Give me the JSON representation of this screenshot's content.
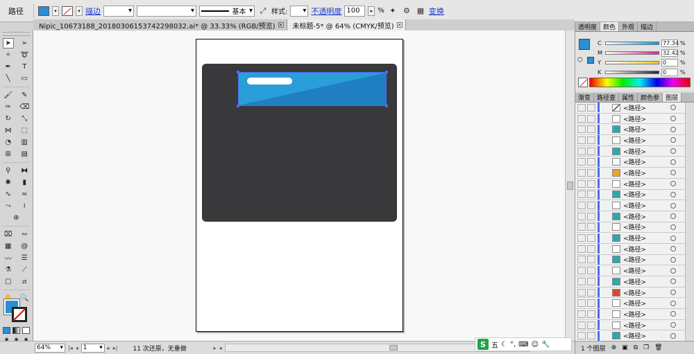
{
  "control_bar": {
    "selection_type": "路径",
    "stroke_link": "描边",
    "stroke_weight": "",
    "brush_name": "",
    "profile": "基本",
    "style_label": "样式:",
    "opacity_link": "不透明度",
    "opacity_value": "100",
    "opacity_unit": "%",
    "transform_link": "变换",
    "fill_color": "#2a8fd5"
  },
  "doc_tabs": [
    {
      "label": "Nipic_10673188_20180306153742298032.ai* @ 33.33% (RGB/预览)",
      "active": false
    },
    {
      "label": "未标题-5* @ 64% (CMYK/预览)",
      "active": true
    }
  ],
  "tools": [
    [
      "selection-tool",
      "direct-selection-tool"
    ],
    [
      "magic-wand-tool",
      "lasso-tool"
    ],
    [
      "pen-tool",
      "type-tool"
    ],
    [
      "line-tool",
      "rectangle-tool"
    ],
    [
      "paintbrush-tool",
      "pencil-tool"
    ],
    [
      "blob-brush-tool",
      "eraser-tool"
    ],
    [
      "rotate-tool",
      "scale-tool"
    ],
    [
      "width-tool",
      "free-transform-tool"
    ],
    [
      "shape-builder-tool",
      "perspective-grid-tool"
    ],
    [
      "mesh-tool",
      "gradient-tool"
    ],
    [
      "eyedropper-tool",
      "blend-tool"
    ],
    [
      "symbol-sprayer-tool",
      "column-graph-tool"
    ],
    [
      "curvature-tool",
      "smooth-tool"
    ],
    [
      "join-tool",
      "reshape-tool"
    ],
    [
      "crosshair-tool"
    ],
    [
      "envelope-tool",
      "warp-tool"
    ],
    [
      "chart-tool",
      "twirl-tool"
    ],
    [
      "wrinkle-tool",
      "align-tool"
    ],
    [
      "eyedropper-alt-tool",
      "knife-tool"
    ],
    [
      "artboard-tool",
      "slice-tool"
    ],
    [
      "hand-tool",
      "zoom-tool"
    ]
  ],
  "status_bar": {
    "zoom": "64%",
    "artboard_num": "1",
    "status_text": "11 次还原，无重做"
  },
  "color_panel": {
    "tabs": [
      "透明度",
      "颜色",
      "外观",
      "描边"
    ],
    "active_tab": "颜色",
    "channels": [
      {
        "name": "C",
        "value": "77.34",
        "color": "#0a9bd8"
      },
      {
        "name": "M",
        "value": "32.42",
        "color": "#d42a8c"
      },
      {
        "name": "Y",
        "value": "0",
        "color": "#e8d020"
      },
      {
        "name": "K",
        "value": "0",
        "color": "#222222"
      }
    ],
    "unit": "%"
  },
  "layers_panel": {
    "tabs": [
      "渐变",
      "路径查",
      "属性",
      "颜色参",
      "图层"
    ],
    "active_tab": "图层",
    "rows": [
      {
        "name": "<路径>",
        "thumb": "#ffffff",
        "slash": true
      },
      {
        "name": "<路径>",
        "thumb": "#ffffff"
      },
      {
        "name": "<路径>",
        "thumb": "#2fa7b0"
      },
      {
        "name": "<路径>",
        "thumb": "#ffffff"
      },
      {
        "name": "<路径>",
        "thumb": "#2fa7b0"
      },
      {
        "name": "<路径>",
        "thumb": "#ffffff"
      },
      {
        "name": "<路径>",
        "thumb": "#e8a32a"
      },
      {
        "name": "<路径>",
        "thumb": "#ffffff"
      },
      {
        "name": "<路径>",
        "thumb": "#2fa7b0"
      },
      {
        "name": "<路径>",
        "thumb": "#ffffff"
      },
      {
        "name": "<路径>",
        "thumb": "#2fa7b0"
      },
      {
        "name": "<路径>",
        "thumb": "#ffffff"
      },
      {
        "name": "<路径>",
        "thumb": "#2fa7b0"
      },
      {
        "name": "<路径>",
        "thumb": "#ffffff"
      },
      {
        "name": "<路径>",
        "thumb": "#2fa7b0"
      },
      {
        "name": "<路径>",
        "thumb": "#ffffff"
      },
      {
        "name": "<路径>",
        "thumb": "#2fa7b0"
      },
      {
        "name": "<路径>",
        "thumb": "#e04a2a"
      },
      {
        "name": "<路径>",
        "thumb": "#ffffff"
      },
      {
        "name": "<路径>",
        "thumb": "#ffffff"
      },
      {
        "name": "<路径>",
        "thumb": "#ffffff"
      },
      {
        "name": "<路径>",
        "thumb": "#2fa7b0"
      }
    ],
    "footer_text": "1 个图层"
  },
  "ime_bar": {
    "logo": "S",
    "mode": "五"
  },
  "canvas": {
    "card_color": "#39393b",
    "banner_color": "#2a9ed8",
    "banner_shade": "#1f7fc2",
    "selection_color": "#4a6cf2"
  }
}
